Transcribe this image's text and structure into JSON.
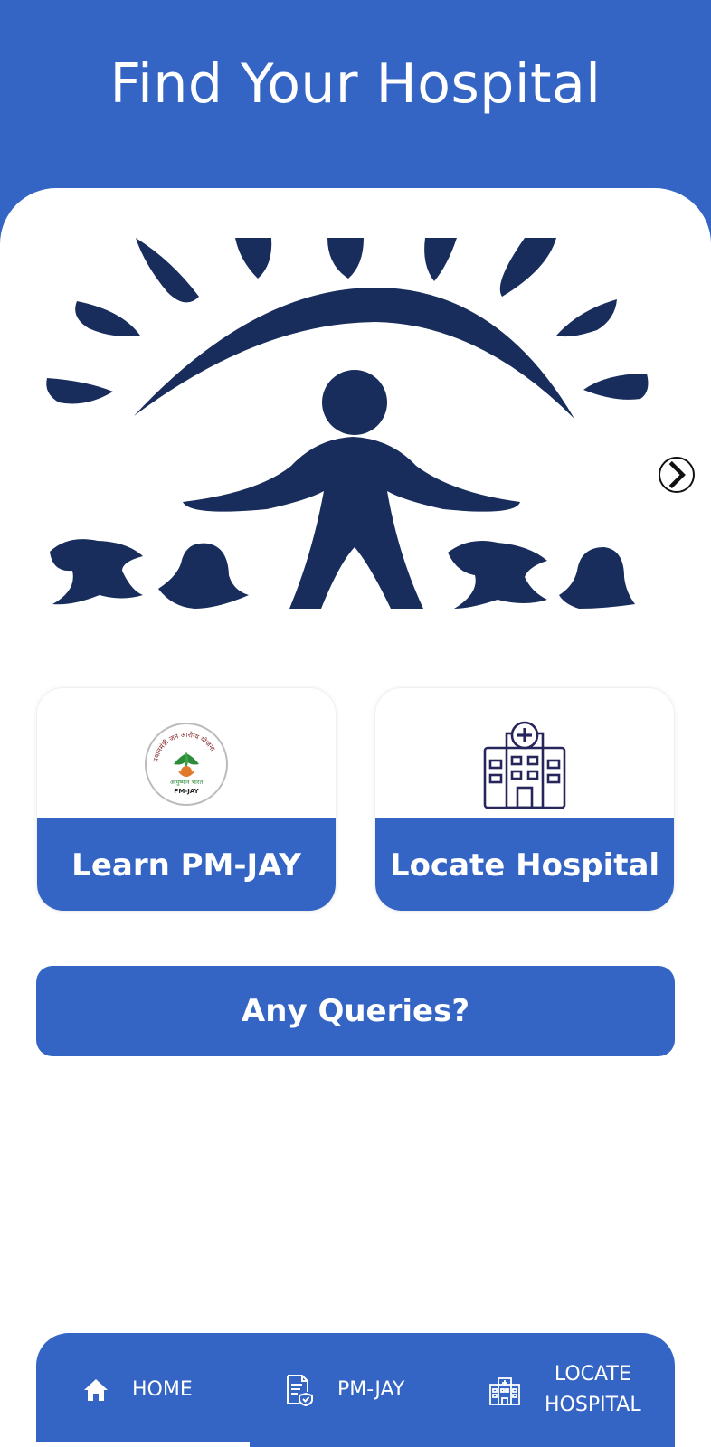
{
  "header": {
    "title": "Find Your Hospital"
  },
  "carousel": {
    "next_icon": "chevron-right-icon"
  },
  "cards": [
    {
      "label": "Learn PM-JAY",
      "icon": "pmjay-logo",
      "logo_text_top": "प्रधानमंत्री जन आरोग्य योजना",
      "logo_text_mid": "आयुष्मान भारत",
      "logo_text_bottom": "PM-JAY"
    },
    {
      "label": "Locate Hospital",
      "icon": "hospital-icon"
    }
  ],
  "query": {
    "label": "Any Queries?"
  },
  "nav": {
    "items": [
      {
        "label": "HOME",
        "icon": "home-icon",
        "active": true
      },
      {
        "label": "PM-JAY",
        "icon": "document-shield-icon",
        "active": false
      },
      {
        "label_line1": "LOCATE",
        "label_line2": "HOSPITAL",
        "icon": "hospital-building-icon",
        "active": false
      }
    ]
  },
  "colors": {
    "primary": "#3565c4",
    "illustration": "#182d5c",
    "white": "#ffffff"
  }
}
